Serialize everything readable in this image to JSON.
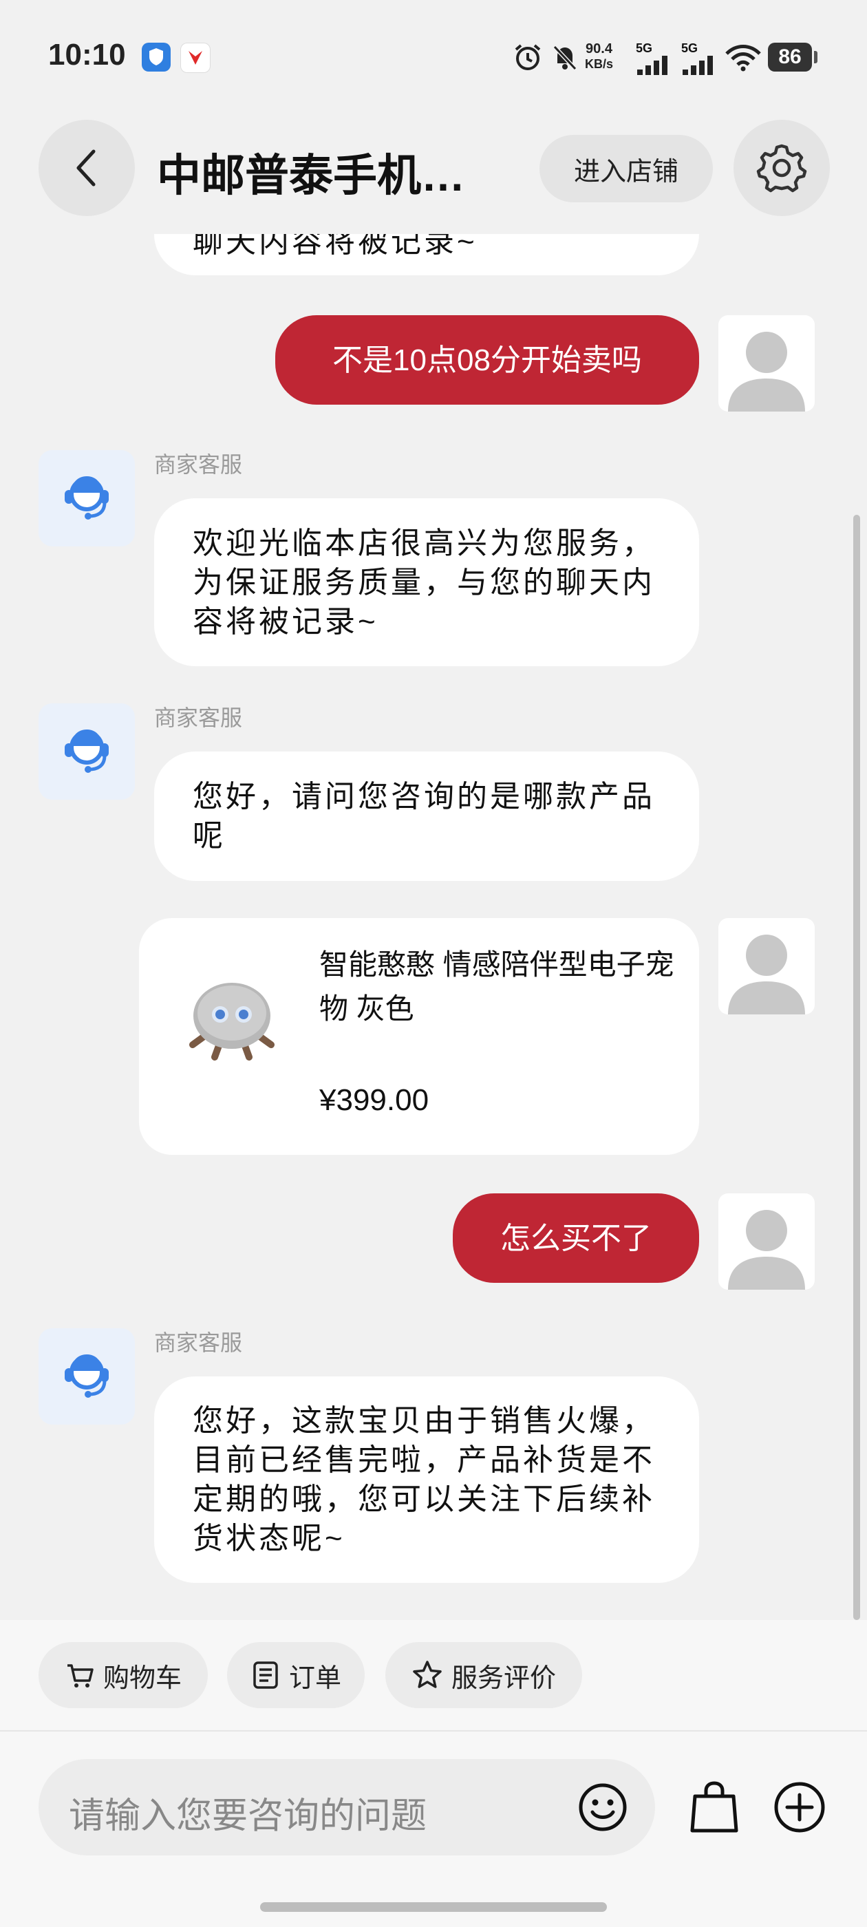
{
  "status_bar": {
    "time": "10:10",
    "net_speed_value": "90.4",
    "net_speed_unit": "KB/s",
    "sig1": "5G",
    "sig2": "5G",
    "battery": "86"
  },
  "header": {
    "title": "中邮普泰手机…",
    "store_button": "进入店铺"
  },
  "messages": {
    "partial_top": "聊天内容将被记录~",
    "m1": "不是10点08分开始卖吗",
    "m2_sender": "商家客服",
    "m2": "欢迎光临本店很高兴为您服务，为保证服务质量，与您的聊天内容将被记录~",
    "m3_sender": "商家客服",
    "m3": "您好，请问您咨询的是哪款产品呢",
    "product_name": "智能憨憨 情感陪伴型电子宠物 灰色",
    "product_price": "¥399.00",
    "m4": "怎么买不了",
    "m5_sender": "商家客服",
    "m5": "您好，这款宝贝由于销售火爆，目前已经售完啦，产品补货是不定期的哦，您可以关注下后续补货状态呢~"
  },
  "quick_actions": {
    "cart": "购物车",
    "order": "订单",
    "review": "服务评价"
  },
  "input": {
    "placeholder": "请输入您要咨询的问题"
  },
  "colors": {
    "accent": "#bf2634",
    "agent_icon": "#3b82e6",
    "background": "#f1f1f1"
  }
}
